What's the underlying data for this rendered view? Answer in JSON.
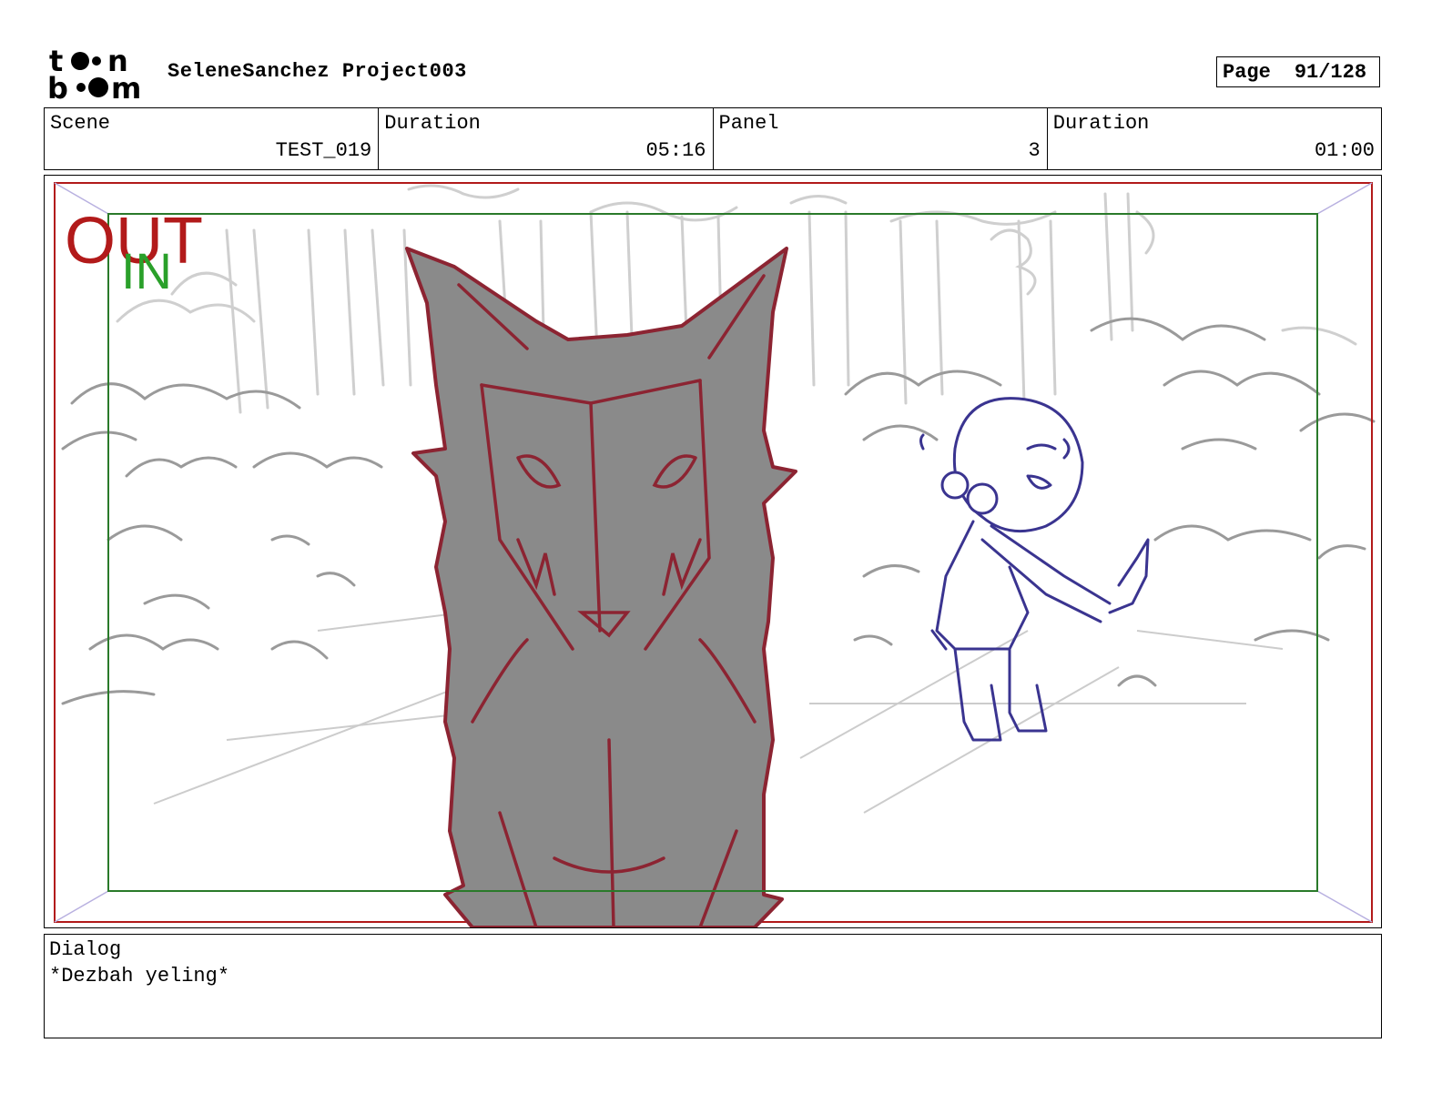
{
  "header": {
    "logo_text_top": "toon",
    "logo_text_bottom": "boom",
    "project_title": "SeleneSanchez Project003",
    "page_label": "Page",
    "page_value": "91/128"
  },
  "info": {
    "scene_label": "Scene",
    "scene_value": "TEST_019",
    "scene_duration_label": "Duration",
    "scene_duration_value": "05:16",
    "panel_label": "Panel",
    "panel_value": "3",
    "panel_duration_label": "Duration",
    "panel_duration_value": "01:00"
  },
  "panel_image": {
    "out_label": "OUT",
    "in_label": "IN",
    "colors": {
      "out_frame": "#b21a1a",
      "in_frame": "#2a7a2a",
      "wolf_fill": "#8a8a8a",
      "wolf_line": "#8c2432",
      "girl_line": "#3a3490",
      "background_line": "#c8c8c8"
    }
  },
  "dialog": {
    "label": "Dialog",
    "text": "*Dezbah yeling*"
  }
}
